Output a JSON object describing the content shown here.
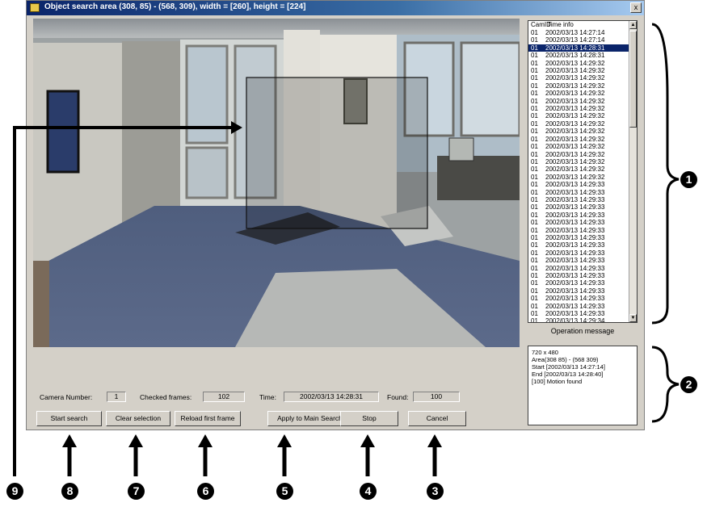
{
  "window": {
    "title": "Object search area (308, 85) - (568, 309), width = [260], height = [224]",
    "close_label": "x"
  },
  "listbox": {
    "header_cam": "CamID",
    "header_time": "Time info",
    "rows": [
      {
        "cam": "01",
        "time": "2002/03/13 14:27:14",
        "selected": false
      },
      {
        "cam": "01",
        "time": "2002/03/13 14:27:14",
        "selected": false
      },
      {
        "cam": "01",
        "time": "2002/03/13 14:28:31",
        "selected": true
      },
      {
        "cam": "01",
        "time": "2002/03/13 14:28:31",
        "selected": false
      },
      {
        "cam": "01",
        "time": "2002/03/13 14:29:32",
        "selected": false
      },
      {
        "cam": "01",
        "time": "2002/03/13 14:29:32",
        "selected": false
      },
      {
        "cam": "01",
        "time": "2002/03/13 14:29:32",
        "selected": false
      },
      {
        "cam": "01",
        "time": "2002/03/13 14:29:32",
        "selected": false
      },
      {
        "cam": "01",
        "time": "2002/03/13 14:29:32",
        "selected": false
      },
      {
        "cam": "01",
        "time": "2002/03/13 14:29:32",
        "selected": false
      },
      {
        "cam": "01",
        "time": "2002/03/13 14:29:32",
        "selected": false
      },
      {
        "cam": "01",
        "time": "2002/03/13 14:29:32",
        "selected": false
      },
      {
        "cam": "01",
        "time": "2002/03/13 14:29:32",
        "selected": false
      },
      {
        "cam": "01",
        "time": "2002/03/13 14:29:32",
        "selected": false
      },
      {
        "cam": "01",
        "time": "2002/03/13 14:29:32",
        "selected": false
      },
      {
        "cam": "01",
        "time": "2002/03/13 14:29:32",
        "selected": false
      },
      {
        "cam": "01",
        "time": "2002/03/13 14:29:32",
        "selected": false
      },
      {
        "cam": "01",
        "time": "2002/03/13 14:29:32",
        "selected": false
      },
      {
        "cam": "01",
        "time": "2002/03/13 14:29:32",
        "selected": false
      },
      {
        "cam": "01",
        "time": "2002/03/13 14:29:32",
        "selected": false
      },
      {
        "cam": "01",
        "time": "2002/03/13 14:29:33",
        "selected": false
      },
      {
        "cam": "01",
        "time": "2002/03/13 14:29:33",
        "selected": false
      },
      {
        "cam": "01",
        "time": "2002/03/13 14:29:33",
        "selected": false
      },
      {
        "cam": "01",
        "time": "2002/03/13 14:29:33",
        "selected": false
      },
      {
        "cam": "01",
        "time": "2002/03/13 14:29:33",
        "selected": false
      },
      {
        "cam": "01",
        "time": "2002/03/13 14:29:33",
        "selected": false
      },
      {
        "cam": "01",
        "time": "2002/03/13 14:29:33",
        "selected": false
      },
      {
        "cam": "01",
        "time": "2002/03/13 14:29:33",
        "selected": false
      },
      {
        "cam": "01",
        "time": "2002/03/13 14:29:33",
        "selected": false
      },
      {
        "cam": "01",
        "time": "2002/03/13 14:29:33",
        "selected": false
      },
      {
        "cam": "01",
        "time": "2002/03/13 14:29:33",
        "selected": false
      },
      {
        "cam": "01",
        "time": "2002/03/13 14:29:33",
        "selected": false
      },
      {
        "cam": "01",
        "time": "2002/03/13 14:29:33",
        "selected": false
      },
      {
        "cam": "01",
        "time": "2002/03/13 14:29:33",
        "selected": false
      },
      {
        "cam": "01",
        "time": "2002/03/13 14:29:33",
        "selected": false
      },
      {
        "cam": "01",
        "time": "2002/03/13 14:29:33",
        "selected": false
      },
      {
        "cam": "01",
        "time": "2002/03/13 14:29:33",
        "selected": false
      },
      {
        "cam": "01",
        "time": "2002/03/13 14:29:33",
        "selected": false
      },
      {
        "cam": "01",
        "time": "2002/03/13 14:29:34",
        "selected": false
      }
    ]
  },
  "operation_message": {
    "label": "Operation message",
    "lines": [
      "720 x 480",
      "Area(308 85) - (568 309)",
      "Start [2002/03/13 14:27:14]",
      "End [2002/03/13 14:28:40]",
      "[100] Motion found"
    ]
  },
  "status": {
    "camera_number_label": "Camera Number:",
    "camera_number": "1",
    "checked_frames_label": "Checked frames:",
    "checked_frames": "102",
    "time_label": "Time:",
    "time": "2002/03/13  14:28:31",
    "found_label": "Found:",
    "found": "100"
  },
  "buttons": {
    "start_search": "Start search",
    "clear_selection": "Clear selection",
    "reload_first_frame": "Reload first frame",
    "apply_to_main_search": "Apply to Main Search",
    "stop": "Stop",
    "cancel": "Cancel"
  },
  "callouts": [
    "1",
    "2",
    "3",
    "4",
    "5",
    "6",
    "7",
    "8",
    "9"
  ],
  "colors": {
    "selection": "#0a246a",
    "titlebar": "#0a246a",
    "window_face": "#d4d0c8"
  }
}
